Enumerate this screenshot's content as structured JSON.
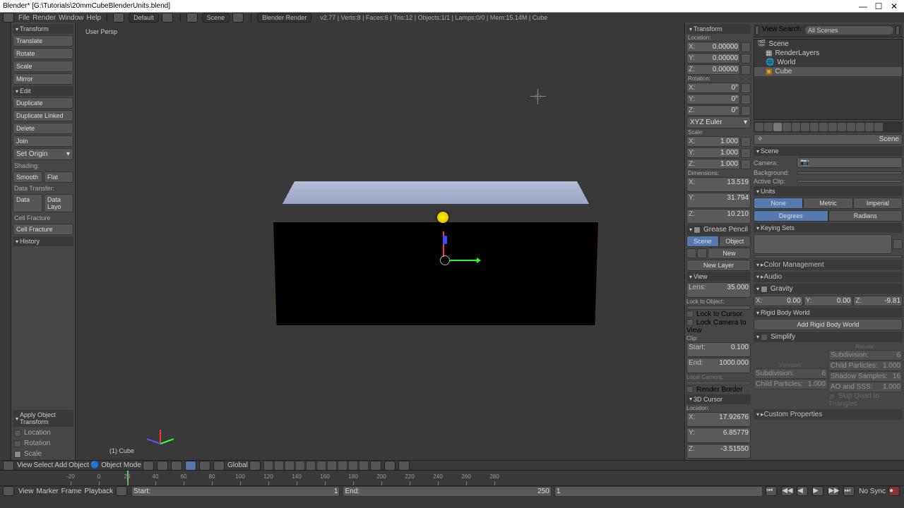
{
  "title": "Blender* [G:\\Tutorials\\20mmCubeBlenderUnits.blend]",
  "menus": [
    "File",
    "Render",
    "Window",
    "Help"
  ],
  "layout": "Default",
  "scene": "Scene",
  "engine": "Blender Render",
  "stats": "v2.77 | Verts:8 | Faces:6 | Tris:12 | Objects:1/1 | Lamps:0/0 | Mem:15.14M | Cube",
  "viewport": {
    "label": "User Persp",
    "obj": "(1) Cube"
  },
  "tool": {
    "transform": "Transform",
    "translate": "Translate",
    "rotate": "Rotate",
    "scale": "Scale",
    "mirror": "Mirror",
    "edit": "Edit",
    "duplicate": "Duplicate",
    "duplink": "Duplicate Linked",
    "delete": "Delete",
    "join": "Join",
    "setorigin": "Set Origin",
    "shading": "Shading:",
    "smooth": "Smooth",
    "flat": "Flat",
    "datatransfer": "Data Transfer:",
    "data": "Data",
    "datalayout": "Data Layo",
    "cellfracture": "Cell Fracture",
    "cellfracture2": "Cell Fracture",
    "history": "History",
    "apply": "Apply Object Transform",
    "loc": "Location",
    "rot": "Rotation",
    "sca": "Scale"
  },
  "props": {
    "transform": "Transform",
    "location": "Location:",
    "loc_x": "0.00000",
    "loc_y": "0.00000",
    "loc_z": "0.00000",
    "rotation": "Rotation:",
    "rot_x": "0°",
    "rot_y": "0°",
    "rot_z": "0°",
    "rotmode": "XYZ Euler",
    "scale": "Scale:",
    "sc_x": "1.000",
    "sc_y": "1.000",
    "sc_z": "1.000",
    "dimensions": "Dimensions:",
    "dim_x": "13.519",
    "dim_y": "31.794",
    "dim_z": "10.210",
    "gp": "Grease Pencil",
    "gp_scene": "Scene",
    "gp_object": "Object",
    "gp_new": "New",
    "gp_newlayer": "New Layer",
    "view": "View",
    "lens_l": "Lens:",
    "lens": "35.000",
    "locktoobj": "Lock to Object:",
    "locktocursor": "Lock to Cursor",
    "lockcam": "Lock Camera to View",
    "clip": "Clip:",
    "clip_start_l": "Start:",
    "clip_start": "0.100",
    "clip_end_l": "End:",
    "clip_end": "1000.000",
    "localcam": "Local Camera:",
    "renderborder": "Render Border",
    "cursor3d": "3D Cursor",
    "cursorloc": "Location:",
    "cx": "17.92676",
    "cy": "6.85779",
    "cz": "-3.51550"
  },
  "outliner": {
    "view": "View",
    "search": "Search:",
    "scenes": "All Scenes",
    "scene": "Scene",
    "renderlayers": "RenderLayers",
    "world": "World",
    "cube": "Cube"
  },
  "scpanel": {
    "scene": "Scene",
    "camera": "Camera:",
    "background": "Background:",
    "activeclip": "Active Clip:",
    "units": "Units",
    "none": "None",
    "metric": "Metric",
    "imperial": "Imperial",
    "degrees": "Degrees",
    "radians": "Radians",
    "keying": "Keying Sets",
    "colormgmt": "Color Management",
    "audio": "Audio",
    "gravity": "Gravity",
    "gx": "0.00",
    "gy": "0.00",
    "gz": "-9.81",
    "rbw": "Rigid Body World",
    "addrbw": "Add Rigid Body World",
    "simplify": "Simplify",
    "viewport_h": "Viewport:",
    "render_h": "Render:",
    "subdiv": "Subdivision:",
    "subdiv_v": "6",
    "childp": "Child Particles:",
    "childp_v": "1.000",
    "shadowsamp": "Shadow Samples:",
    "shadowsamp_v": "16",
    "aosss": "AO and SSS:",
    "aosss_v": "1.000",
    "skipquad": "Skip Quad to Triangles",
    "custom": "Custom Properties"
  },
  "header": {
    "view": "View",
    "select": "Select",
    "add": "Add",
    "object": "Object",
    "mode": "Object Mode",
    "global": "Global"
  },
  "timeline": {
    "ticks": [
      -20,
      0,
      20,
      40,
      60,
      80,
      100,
      120,
      140,
      160,
      180,
      200,
      220,
      240,
      260,
      280
    ],
    "view": "View",
    "marker": "Marker",
    "frame": "Frame",
    "playback": "Playback",
    "start_l": "Start:",
    "start": "1",
    "end_l": "End:",
    "end": "250",
    "cur": "1",
    "nosync": "No Sync"
  },
  "win": {
    "min": "—",
    "max": "☐",
    "close": "✕"
  }
}
